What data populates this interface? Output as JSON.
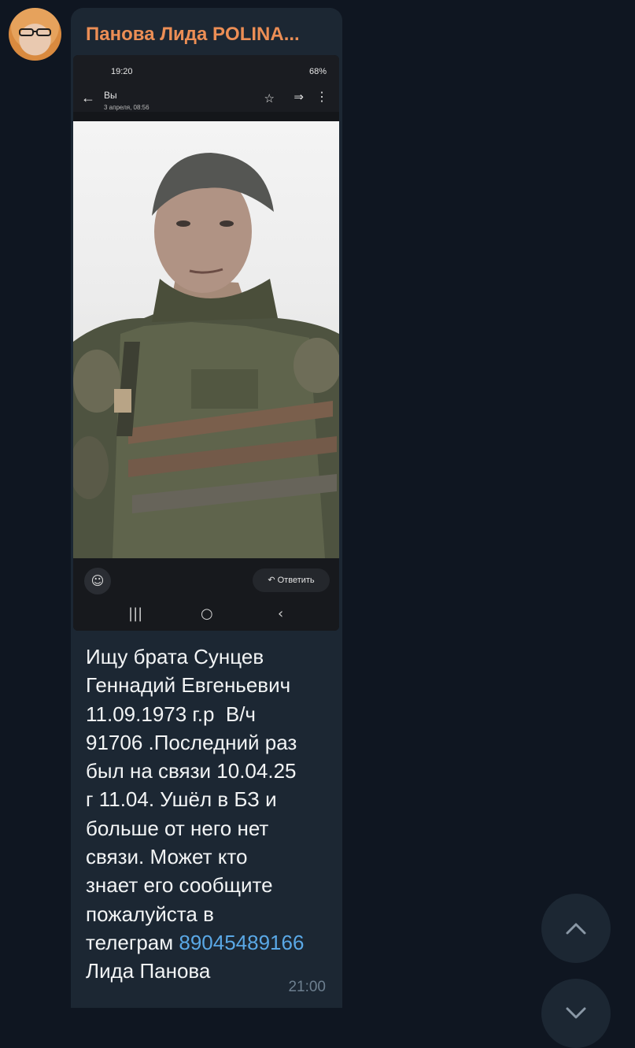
{
  "message": {
    "sender": "Панова Лида POLINA...",
    "text_lines": [
      "Ищу брата Сунцев",
      "Геннадий Евгеньевич",
      "11.09.1973 г.р  В/ч",
      "91706 .Последний раз",
      "был на связи 10.04.25",
      "г 11.04. Ушёл в БЗ и",
      "больше от него нет",
      "связи. Может кто",
      "знает его сообщите",
      "пожалуйста в"
    ],
    "last_prefix": "телеграм ",
    "phone": "89045489166",
    "signature": "Лида Панова",
    "time": "21:00"
  },
  "screenshot": {
    "status_time": "19:20",
    "battery": "68%",
    "title": "Вы",
    "date": "3 апреля, 08:56",
    "reply_label": "Ответить"
  },
  "icons": {
    "scroll_up": "chevron-up-icon",
    "scroll_down": "chevron-down-icon",
    "emoji": "emoji-icon",
    "back": "arrow-left-icon",
    "star": "star-icon",
    "forward": "forward-icon",
    "more": "more-vertical-icon"
  },
  "colors": {
    "background": "#0f1621",
    "bubble": "#1c2733",
    "sender_name": "#ec8e55",
    "message_text": "#f2f4f5",
    "link": "#5aa8e6",
    "timestamp": "#6d7f8f"
  }
}
